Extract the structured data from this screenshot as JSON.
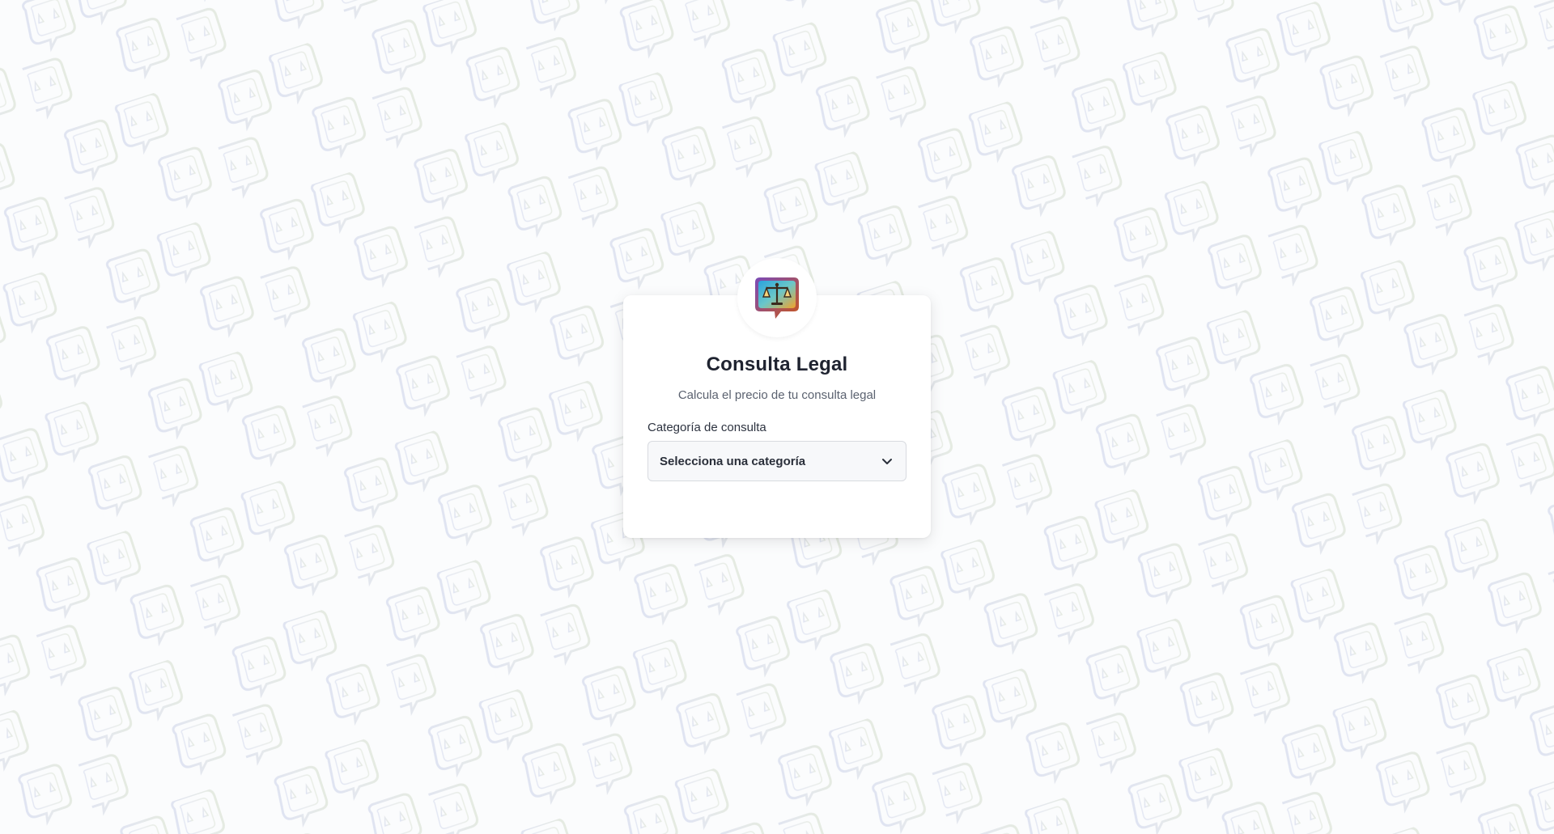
{
  "app": {
    "title": "Consulta Legal",
    "subtitle": "Calcula el precio de tu consulta legal",
    "logo_icon": "scales-of-justice-chat-icon"
  },
  "form": {
    "category_label": "Categoría de consulta",
    "category_selected": "Selecciona una categoría",
    "category_icon": "chevron-down-icon"
  },
  "colors": {
    "pattern_left": "#c9cfe6",
    "pattern_right": "#d6ddd0",
    "logo_blue": "#2a9bd6",
    "logo_gold": "#e8a42a",
    "logo_purple": "#6a3da0"
  }
}
